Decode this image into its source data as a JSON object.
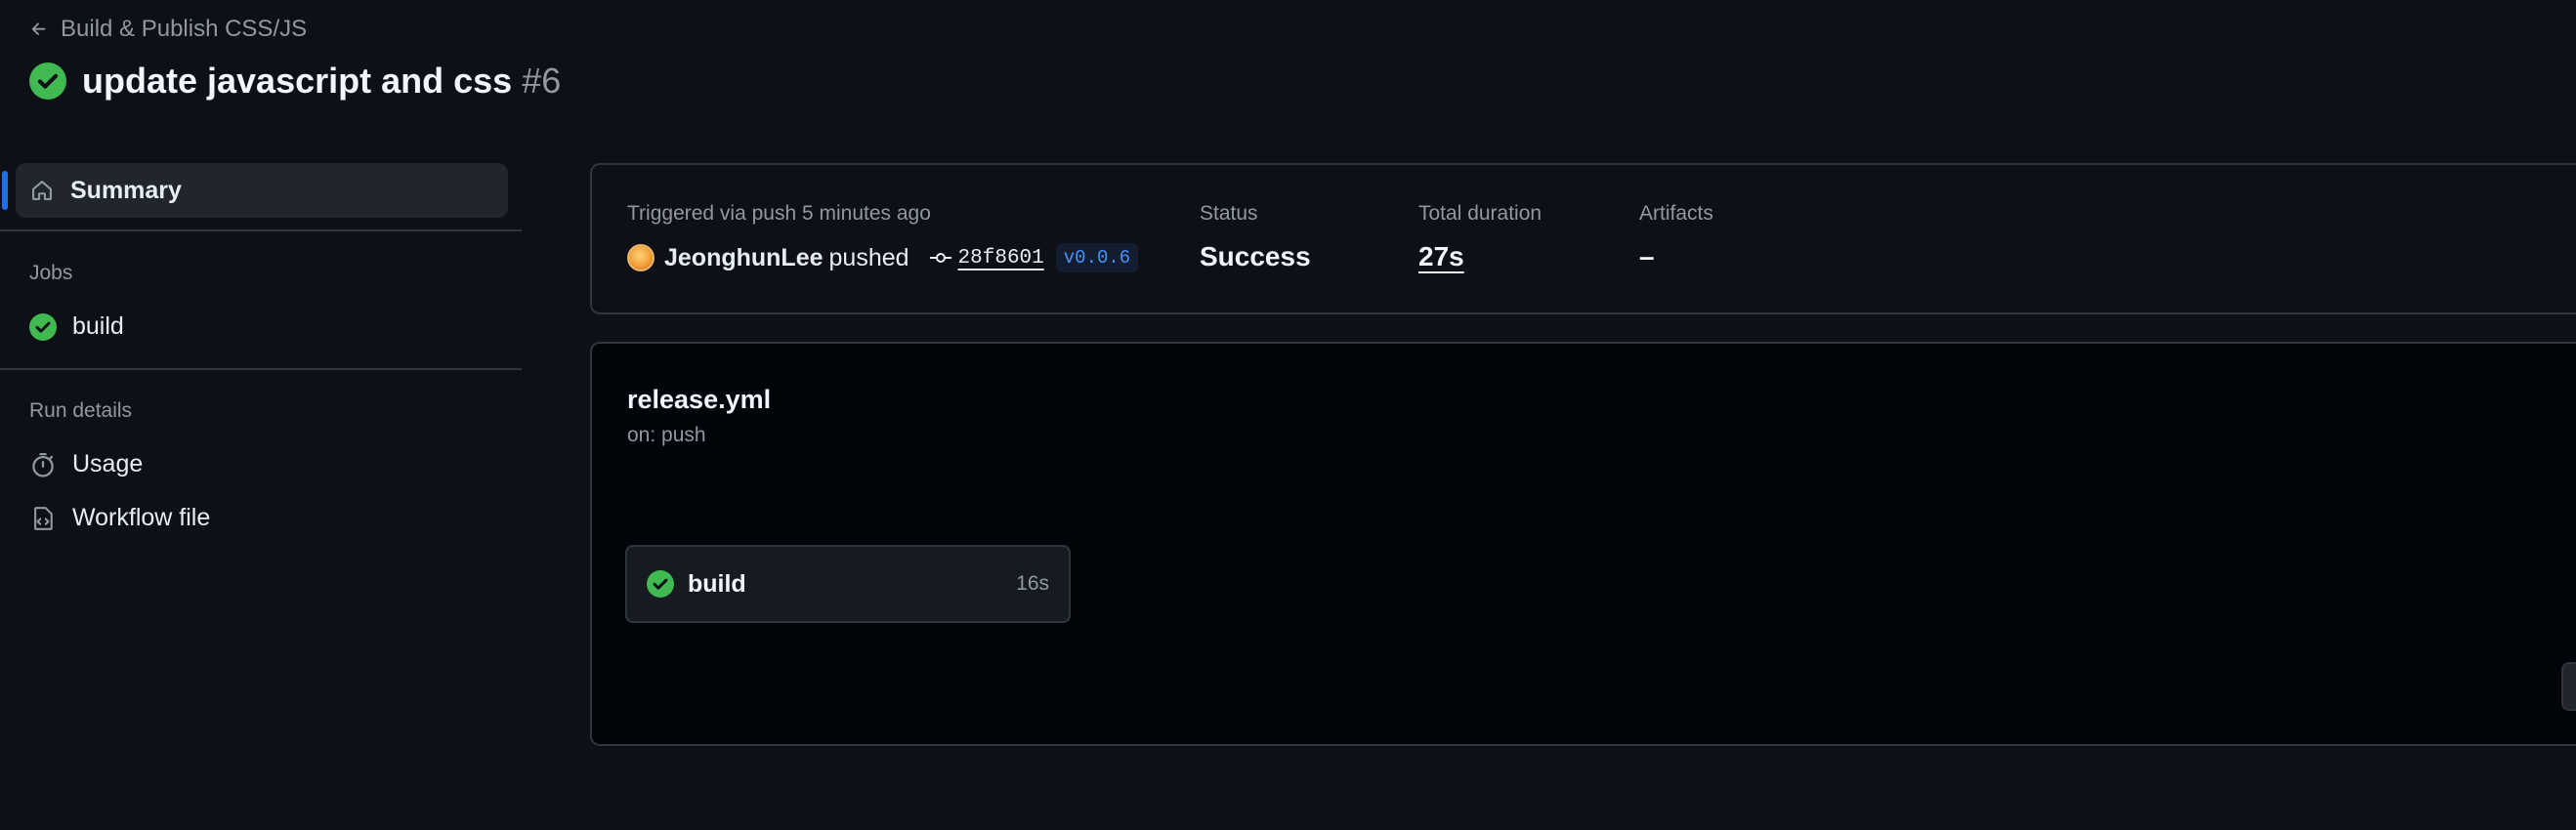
{
  "header": {
    "back_label": "Build & Publish CSS/JS",
    "run_title": "update javascript and css",
    "run_number": "#6"
  },
  "sidebar": {
    "summary_label": "Summary",
    "jobs_heading": "Jobs",
    "jobs": [
      {
        "label": "build"
      }
    ],
    "run_details_heading": "Run details",
    "usage_label": "Usage",
    "workflow_file_label": "Workflow file"
  },
  "summary": {
    "triggered_text": "Triggered via push 5 minutes ago",
    "actor": "JeonghunLee",
    "action": "pushed",
    "commit_sha": "28f8601",
    "tag": "v0.0.6",
    "status_label": "Status",
    "status_value": "Success",
    "duration_label": "Total duration",
    "duration_value": "27s",
    "artifacts_label": "Artifacts",
    "artifacts_value": "–"
  },
  "workflow": {
    "file_name": "release.yml",
    "trigger": "on: push",
    "jobs": [
      {
        "name": "build",
        "duration": "16s"
      }
    ]
  },
  "icons": {
    "back": "arrow-left-icon",
    "status": "check-circle-fill-icon",
    "summary": "home-icon",
    "usage": "stopwatch-icon",
    "workflow_file": "file-code-icon",
    "commit": "git-commit-icon"
  },
  "colors": {
    "background": "#0d1117",
    "success": "#3fb950",
    "accent": "#1f6feb",
    "link_blue": "#4493f8",
    "muted_text": "#9198a1",
    "border": "#30363d"
  }
}
